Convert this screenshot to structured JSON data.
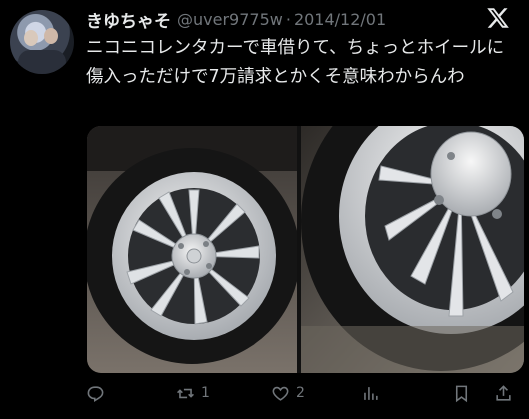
{
  "tweet": {
    "display_name": "きゆちゃそ",
    "handle": "@uver9775w",
    "separator": "·",
    "date": "2014/12/01",
    "text": "ニコニコレンタカーで車借りて、ちょっとホイールに傷入っただけで7万請求とかくそ意味わからんわ",
    "images": [
      {
        "name": "wheel-photo-1"
      },
      {
        "name": "wheel-photo-2"
      }
    ]
  },
  "actions": {
    "reply": {
      "icon": "reply-icon",
      "count": ""
    },
    "retweet": {
      "icon": "retweet-icon",
      "count": "1"
    },
    "like": {
      "icon": "heart-icon",
      "count": "2"
    },
    "views": {
      "icon": "views-icon",
      "count": ""
    },
    "bookmark": {
      "icon": "bookmark-icon",
      "count": ""
    },
    "share": {
      "icon": "share-icon",
      "count": ""
    }
  },
  "colors": {
    "background": "#000000",
    "text": "#e7e9ea",
    "muted": "#71767b"
  }
}
